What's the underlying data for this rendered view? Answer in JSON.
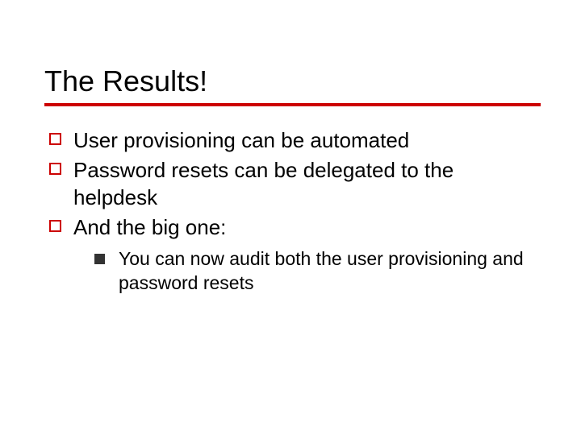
{
  "title": "The Results!",
  "bullets": [
    {
      "text": "User provisioning can be automated"
    },
    {
      "text": "Password resets can be delegated to the helpdesk"
    },
    {
      "text": "And the big one:",
      "sub": [
        {
          "text": "You can now audit both the user provisioning and password resets"
        }
      ]
    }
  ]
}
